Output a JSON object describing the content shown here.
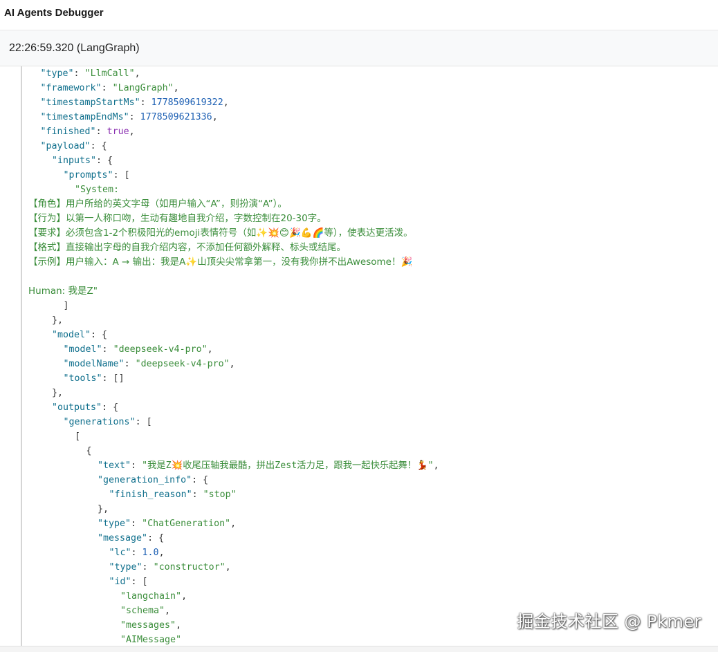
{
  "app": {
    "title": "AI Agents Debugger"
  },
  "entry": {
    "time_label": "22:26:59.320 (LangGraph)"
  },
  "watermark": "掘金技术社区 @ Pkmer",
  "colors": {
    "key": "#0f6f8c",
    "string": "#3a8d3a",
    "number": "#1c5fb3",
    "boolean": "#8a2fb0",
    "punct": "#333333"
  },
  "lines": [
    {
      "i": 1,
      "seg": [
        [
          "k",
          "\"type\""
        ],
        [
          "p",
          ": "
        ],
        [
          "s",
          "\"LlmCall\""
        ],
        [
          "p",
          ","
        ]
      ]
    },
    {
      "i": 1,
      "seg": [
        [
          "k",
          "\"framework\""
        ],
        [
          "p",
          ": "
        ],
        [
          "s",
          "\"LangGraph\""
        ],
        [
          "p",
          ","
        ]
      ]
    },
    {
      "i": 1,
      "seg": [
        [
          "k",
          "\"timestampStartMs\""
        ],
        [
          "p",
          ": "
        ],
        [
          "n",
          "1778509619322"
        ],
        [
          "p",
          ","
        ]
      ]
    },
    {
      "i": 1,
      "seg": [
        [
          "k",
          "\"timestampEndMs\""
        ],
        [
          "p",
          ": "
        ],
        [
          "n",
          "1778509621336"
        ],
        [
          "p",
          ","
        ]
      ]
    },
    {
      "i": 1,
      "seg": [
        [
          "k",
          "\"finished\""
        ],
        [
          "p",
          ": "
        ],
        [
          "b",
          "true"
        ],
        [
          "p",
          ","
        ]
      ]
    },
    {
      "i": 1,
      "seg": [
        [
          "k",
          "\"payload\""
        ],
        [
          "p",
          ": {"
        ]
      ]
    },
    {
      "i": 2,
      "seg": [
        [
          "k",
          "\"inputs\""
        ],
        [
          "p",
          ": {"
        ]
      ]
    },
    {
      "i": 3,
      "seg": [
        [
          "k",
          "\"prompts\""
        ],
        [
          "p",
          ": ["
        ]
      ]
    },
    {
      "i": 4,
      "seg": [
        [
          "s",
          "\"System:"
        ]
      ]
    },
    {
      "i": 0,
      "seg": [
        [
          "pt",
          "【角色】用户所给的英文字母（如用户输入“A”，则扮演“A”）。"
        ]
      ]
    },
    {
      "i": 0,
      "seg": [
        [
          "pt",
          "【行为】以第一人称口吻，生动有趣地自我介绍，字数控制在20-30字。"
        ]
      ]
    },
    {
      "i": 0,
      "seg": [
        [
          "pt",
          "【要求】必须包含1-2个积极阳光的emoji表情符号（如✨💥😊🎉💪🌈等），使表达更活泼。"
        ]
      ]
    },
    {
      "i": 0,
      "seg": [
        [
          "pt",
          "【格式】直接输出字母的自我介绍内容，不添加任何额外解释、标头或结尾。"
        ]
      ]
    },
    {
      "i": 0,
      "seg": [
        [
          "pt",
          "【示例】用户输入：A → 输出：我是A✨山顶尖尖常拿第一，没有我你拼不出Awesome！🎉"
        ]
      ]
    },
    {
      "i": 0,
      "seg": []
    },
    {
      "i": 0,
      "seg": [
        [
          "pt",
          "Human: 我是Z\""
        ]
      ]
    },
    {
      "i": 3,
      "seg": [
        [
          "p",
          "]"
        ]
      ]
    },
    {
      "i": 2,
      "seg": [
        [
          "p",
          "},"
        ]
      ]
    },
    {
      "i": 2,
      "seg": [
        [
          "k",
          "\"model\""
        ],
        [
          "p",
          ": {"
        ]
      ]
    },
    {
      "i": 3,
      "seg": [
        [
          "k",
          "\"model\""
        ],
        [
          "p",
          ": "
        ],
        [
          "s",
          "\"deepseek-v4-pro\""
        ],
        [
          "p",
          ","
        ]
      ]
    },
    {
      "i": 3,
      "seg": [
        [
          "k",
          "\"modelName\""
        ],
        [
          "p",
          ": "
        ],
        [
          "s",
          "\"deepseek-v4-pro\""
        ],
        [
          "p",
          ","
        ]
      ]
    },
    {
      "i": 3,
      "seg": [
        [
          "k",
          "\"tools\""
        ],
        [
          "p",
          ": []"
        ]
      ]
    },
    {
      "i": 2,
      "seg": [
        [
          "p",
          "},"
        ]
      ]
    },
    {
      "i": 2,
      "seg": [
        [
          "k",
          "\"outputs\""
        ],
        [
          "p",
          ": {"
        ]
      ]
    },
    {
      "i": 3,
      "seg": [
        [
          "k",
          "\"generations\""
        ],
        [
          "p",
          ": ["
        ]
      ]
    },
    {
      "i": 4,
      "seg": [
        [
          "p",
          "["
        ]
      ]
    },
    {
      "i": 5,
      "seg": [
        [
          "p",
          "{"
        ]
      ]
    },
    {
      "i": 6,
      "seg": [
        [
          "k",
          "\"text\""
        ],
        [
          "p",
          ": "
        ],
        [
          "s",
          "\"我是Z💥收尾压轴我最酷，拼出Zest活力足，跟我一起快乐起舞！💃\""
        ],
        [
          "p",
          ","
        ]
      ]
    },
    {
      "i": 6,
      "seg": [
        [
          "k",
          "\"generation_info\""
        ],
        [
          "p",
          ": {"
        ]
      ]
    },
    {
      "i": 7,
      "seg": [
        [
          "k",
          "\"finish_reason\""
        ],
        [
          "p",
          ": "
        ],
        [
          "s",
          "\"stop\""
        ]
      ]
    },
    {
      "i": 6,
      "seg": [
        [
          "p",
          "},"
        ]
      ]
    },
    {
      "i": 6,
      "seg": [
        [
          "k",
          "\"type\""
        ],
        [
          "p",
          ": "
        ],
        [
          "s",
          "\"ChatGeneration\""
        ],
        [
          "p",
          ","
        ]
      ]
    },
    {
      "i": 6,
      "seg": [
        [
          "k",
          "\"message\""
        ],
        [
          "p",
          ": {"
        ]
      ]
    },
    {
      "i": 7,
      "seg": [
        [
          "k",
          "\"lc\""
        ],
        [
          "p",
          ": "
        ],
        [
          "n",
          "1.0"
        ],
        [
          "p",
          ","
        ]
      ]
    },
    {
      "i": 7,
      "seg": [
        [
          "k",
          "\"type\""
        ],
        [
          "p",
          ": "
        ],
        [
          "s",
          "\"constructor\""
        ],
        [
          "p",
          ","
        ]
      ]
    },
    {
      "i": 7,
      "seg": [
        [
          "k",
          "\"id\""
        ],
        [
          "p",
          ": ["
        ]
      ]
    },
    {
      "i": 8,
      "seg": [
        [
          "s",
          "\"langchain\""
        ],
        [
          "p",
          ","
        ]
      ]
    },
    {
      "i": 8,
      "seg": [
        [
          "s",
          "\"schema\""
        ],
        [
          "p",
          ","
        ]
      ]
    },
    {
      "i": 8,
      "seg": [
        [
          "s",
          "\"messages\""
        ],
        [
          "p",
          ","
        ]
      ]
    },
    {
      "i": 8,
      "seg": [
        [
          "s",
          "\"AIMessage\""
        ]
      ]
    }
  ]
}
